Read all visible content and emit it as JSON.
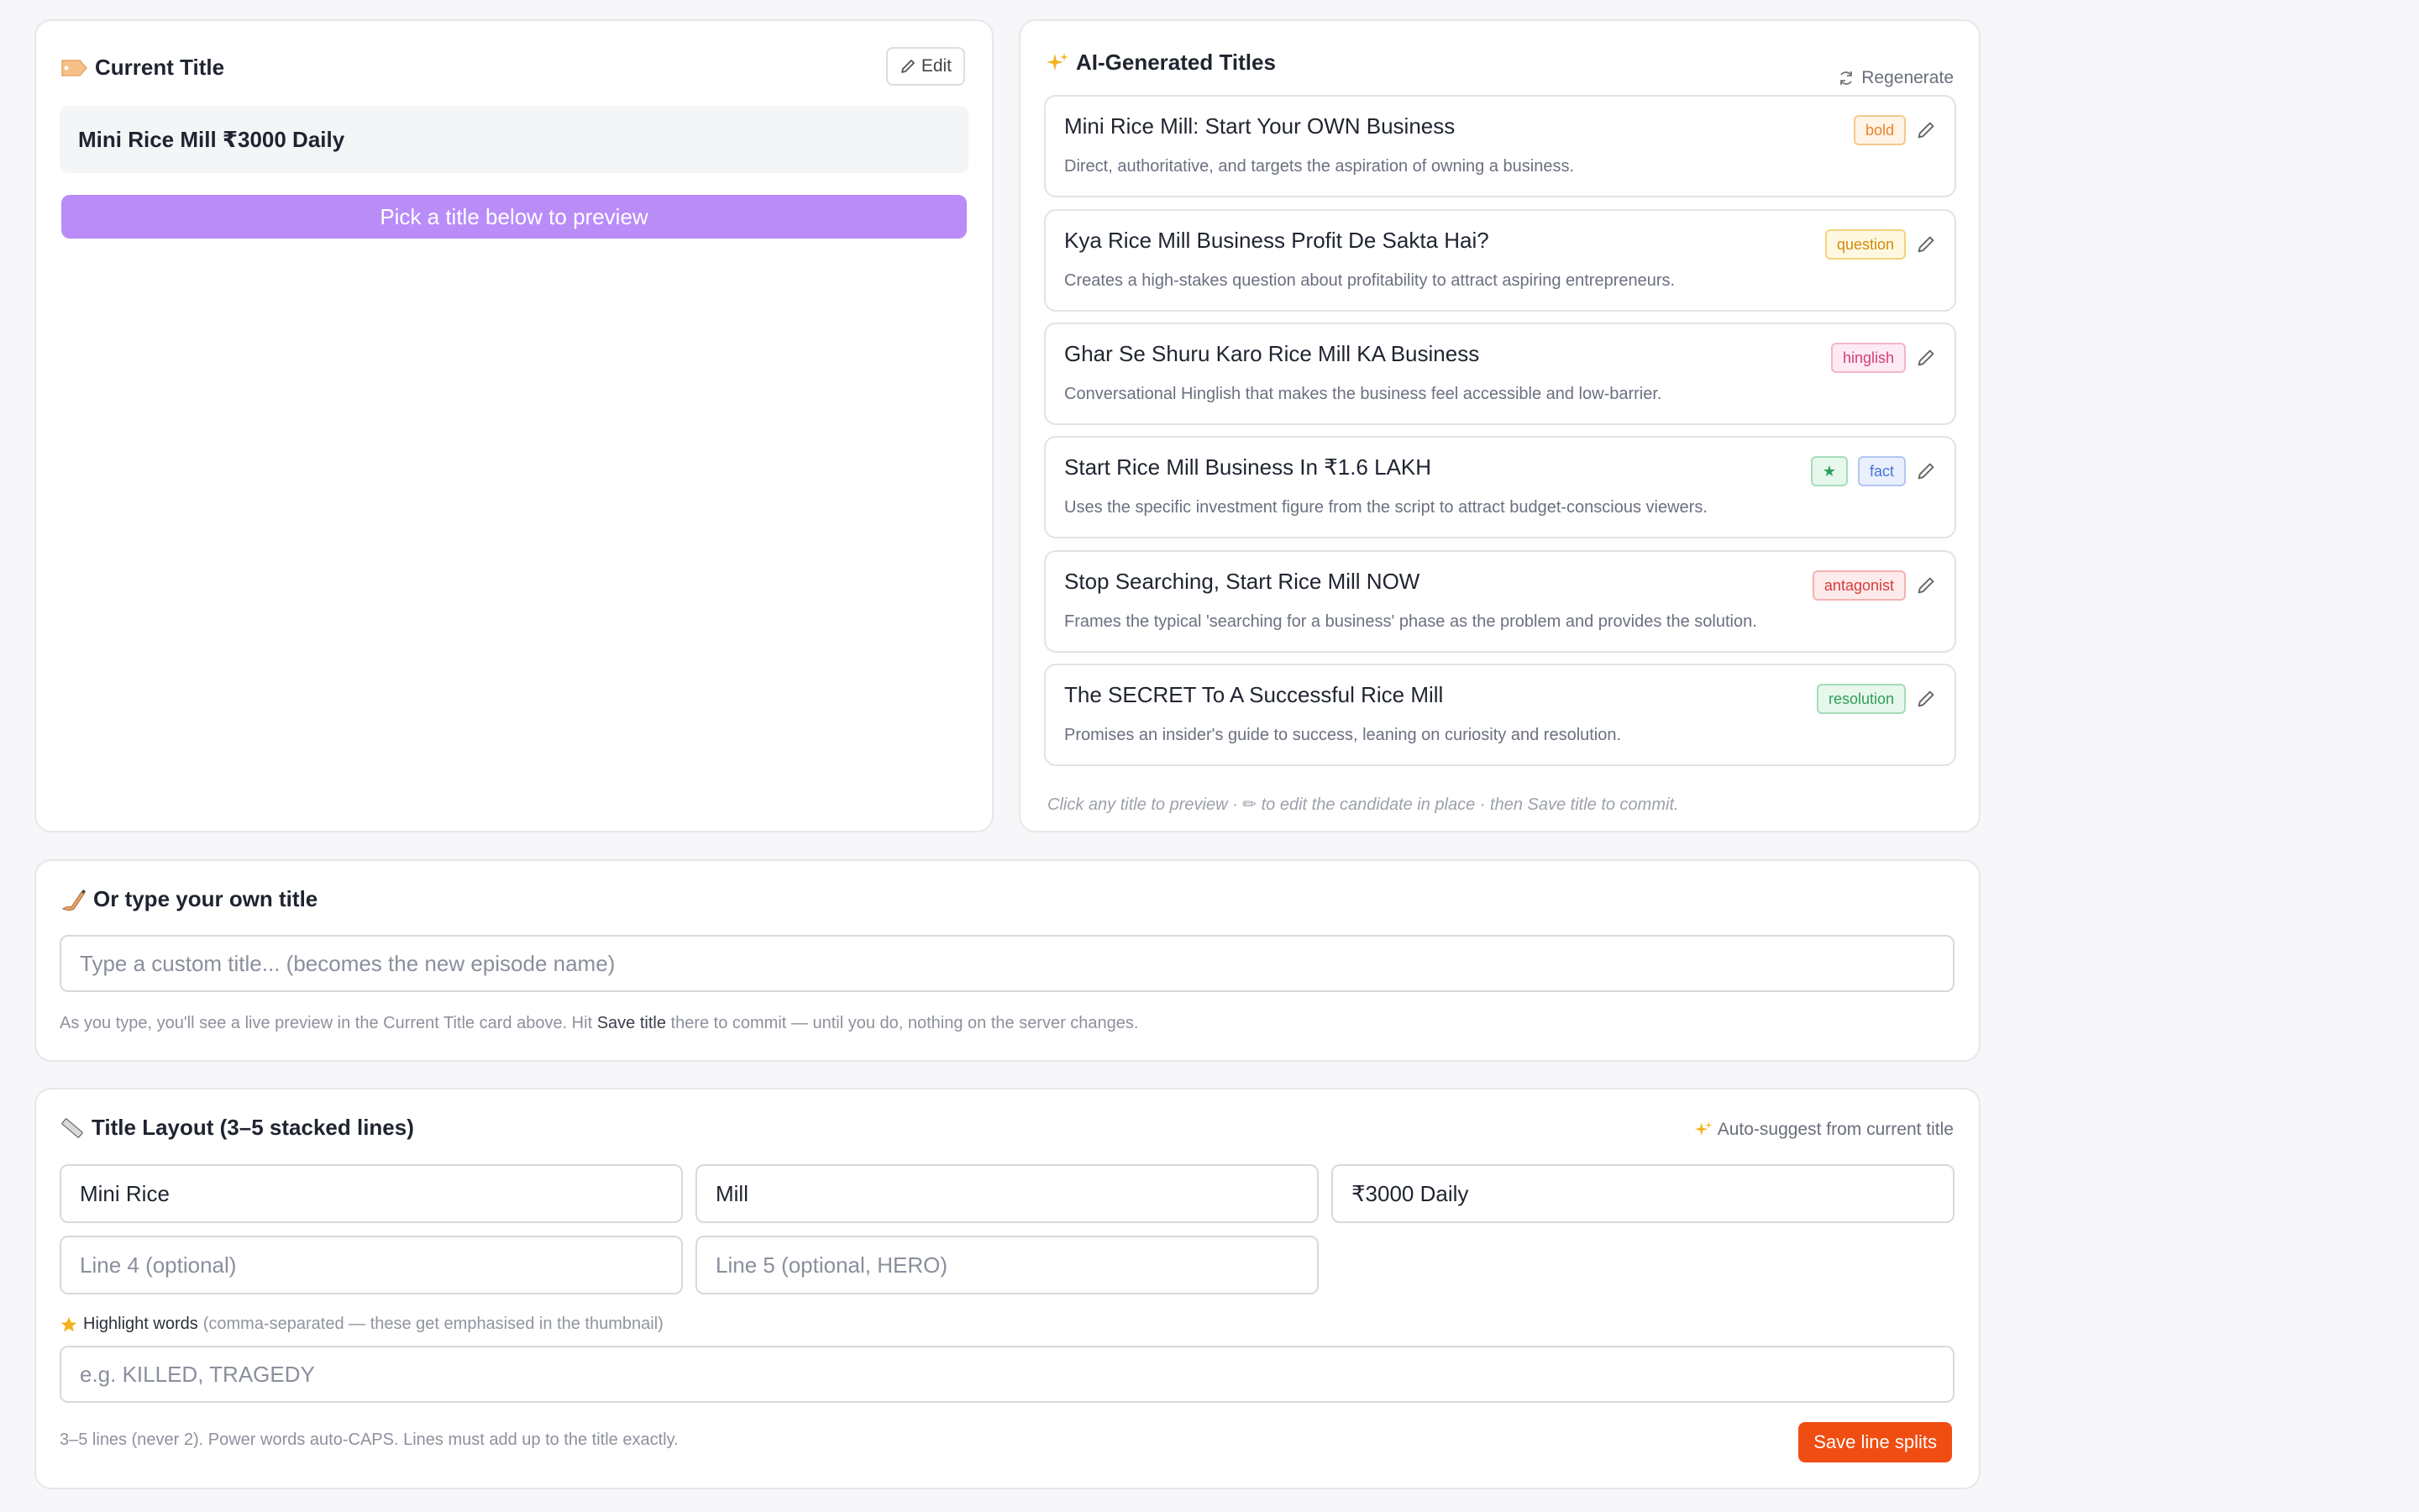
{
  "current": {
    "heading": "Current Title",
    "edit_label": "Edit",
    "value": "Mini Rice Mill ₹3000 Daily",
    "preview_hint": "Pick a title below to preview"
  },
  "ai": {
    "heading": "AI-Generated Titles",
    "regenerate_label": "Regenerate",
    "candidates": [
      {
        "title": "Mini Rice Mill: Start Your OWN Business",
        "desc": "Direct, authoritative, and targets the aspiration of owning a business.",
        "tags": [
          "bold"
        ]
      },
      {
        "title": "Kya Rice Mill Business Profit De Sakta Hai?",
        "desc": "Creates a high-stakes question about profitability to attract aspiring entrepreneurs.",
        "tags": [
          "question"
        ]
      },
      {
        "title": "Ghar Se Shuru Karo Rice Mill KA Business",
        "desc": "Conversational Hinglish that makes the business feel accessible and low-barrier.",
        "tags": [
          "hinglish"
        ]
      },
      {
        "title": "Start Rice Mill Business In ₹1.6 LAKH",
        "desc": "Uses the specific investment figure from the script to attract budget-conscious viewers.",
        "tags": [
          "★",
          "fact"
        ]
      },
      {
        "title": "Stop Searching, Start Rice Mill NOW",
        "desc": "Frames the typical 'searching for a business' phase as the problem and provides the solution.",
        "tags": [
          "antagonist"
        ]
      },
      {
        "title": "The SECRET To A Successful Rice Mill",
        "desc": "Promises an insider's guide to success, leaning on curiosity and resolution.",
        "tags": [
          "resolution"
        ]
      }
    ],
    "hint": "Click any title to preview · ✏ to edit the candidate in place · then Save title to commit."
  },
  "custom": {
    "heading": "Or type your own title",
    "placeholder": "Type a custom title... (becomes the new episode name)",
    "note_before": "As you type, you'll see a live preview in the Current Title card above. Hit ",
    "note_bold": "Save title",
    "note_after": " there to commit — until you do, nothing on the server changes."
  },
  "layout": {
    "heading": "Title Layout (3–5 stacked lines)",
    "auto_suggest": "Auto-suggest from current title",
    "lines": [
      "Mini Rice",
      "Mill",
      "₹3000 Daily",
      "",
      ""
    ],
    "line4_placeholder": "Line 4 (optional)",
    "line5_placeholder": "Line 5 (optional, HERO)",
    "highlight_label": "Highlight words",
    "highlight_sub": "(comma-separated — these get emphasised in the thumbnail)",
    "highlight_placeholder": "e.g. KILLED, TRAGEDY",
    "footer_note": "3–5 lines (never 2). Power words auto-CAPS. Lines must add up to the title exactly.",
    "save_label": "Save line splits"
  },
  "colors": {
    "accent_purple": "#b98cf8",
    "save_orange": "#f04d12",
    "tag_bold": "#e8832a",
    "tag_question": "#d18a0a",
    "tag_hinglish": "#d2407c",
    "tag_star": "#2f9e5a",
    "tag_fact": "#4a73d8",
    "tag_antagonist": "#d43b3b",
    "tag_resolution": "#2f9e5a"
  }
}
